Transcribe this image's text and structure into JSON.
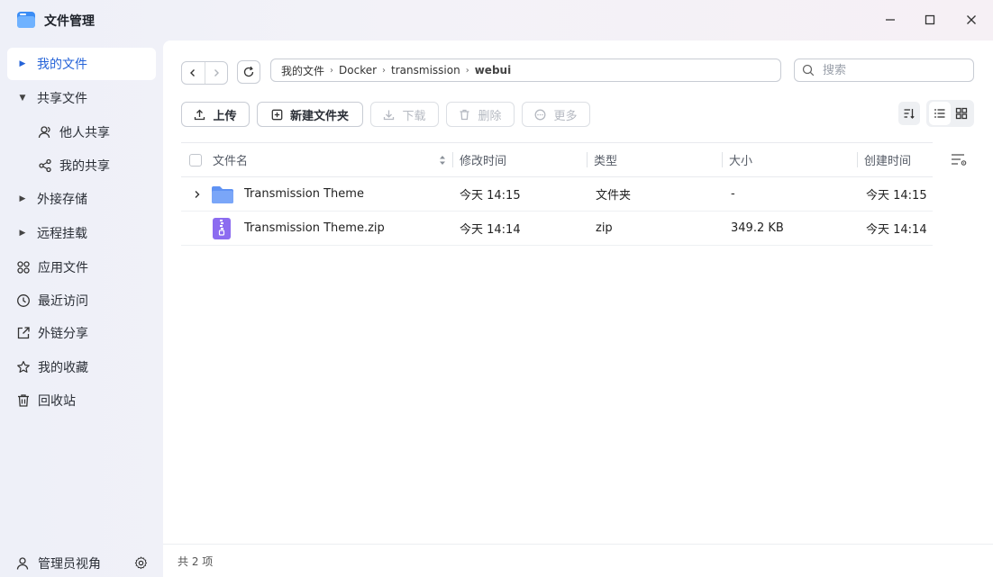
{
  "app": {
    "title": "文件管理"
  },
  "sidebar": {
    "items": [
      {
        "label": "我的文件",
        "icon": "caret-right-icon",
        "active": true
      },
      {
        "label": "共享文件",
        "icon": "caret-down-icon"
      },
      {
        "label": "他人共享",
        "icon": "user-icon"
      },
      {
        "label": "我的共享",
        "icon": "share-icon"
      },
      {
        "label": "外接存储",
        "icon": "caret-right-icon"
      },
      {
        "label": "远程挂载",
        "icon": "caret-right-icon"
      },
      {
        "label": "应用文件",
        "icon": "apps-icon"
      },
      {
        "label": "最近访问",
        "icon": "clock-icon"
      },
      {
        "label": "外链分享",
        "icon": "link-share-icon"
      },
      {
        "label": "我的收藏",
        "icon": "star-icon"
      },
      {
        "label": "回收站",
        "icon": "trash-icon"
      }
    ],
    "footer": {
      "label": "管理员视角"
    }
  },
  "breadcrumb": [
    "我的文件",
    "Docker",
    "transmission",
    "webui"
  ],
  "search": {
    "placeholder": "搜索"
  },
  "toolbar": {
    "upload": "上传",
    "new_folder": "新建文件夹",
    "download": "下载",
    "delete": "删除",
    "more": "更多"
  },
  "table": {
    "headers": {
      "name": "文件名",
      "modified": "修改时间",
      "type": "类型",
      "size": "大小",
      "created": "创建时间"
    },
    "rows": [
      {
        "name": "Transmission Theme",
        "modified": "今天 14:15",
        "type": "文件夹",
        "size": "-",
        "created": "今天 14:15",
        "kind": "folder"
      },
      {
        "name": "Transmission Theme.zip",
        "modified": "今天 14:14",
        "type": "zip",
        "size": "349.2 KB",
        "created": "今天 14:14",
        "kind": "zip"
      }
    ]
  },
  "status": {
    "count_text": "共 2 项"
  },
  "colors": {
    "accent": "#2563d8",
    "folder": "#6e9ff7",
    "zip": "#8c6cf0"
  }
}
